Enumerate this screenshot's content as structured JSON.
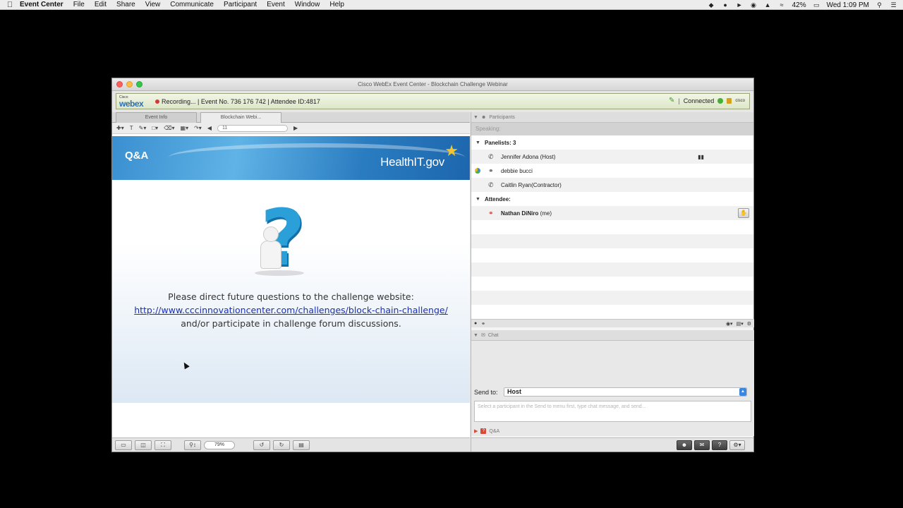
{
  "menubar": {
    "apple": "",
    "app_name": "Event Center",
    "items": [
      "File",
      "Edit",
      "Share",
      "View",
      "Communicate",
      "Participant",
      "Event",
      "Window",
      "Help"
    ],
    "battery": "42%",
    "clock": "Wed 1:09 PM"
  },
  "window": {
    "title": "Cisco WebEx Event Center - Blockchain Challenge Webinar",
    "status": {
      "cisco_label": "Cisco",
      "brand_label": "webex",
      "text": "Recording... | Event No. 736 176 742 | Attendee ID:4817",
      "connection": "Connected",
      "cisco_mark": "cisco"
    },
    "tabs": [
      "Event Info",
      "Blockchain Webi..."
    ],
    "toolbar": {
      "page_field": "11"
    },
    "slide": {
      "header_title": "Q&A",
      "brand": "HealthIT.gov",
      "line1": "Please direct future questions to the challenge website:",
      "link": "http://www.cccinnovationcenter.com/challenges/block-chain-challenge/",
      "line3": "and/or participate in challenge forum discussions."
    },
    "zoom": "79%"
  },
  "participants": {
    "panel_title": "Participants",
    "speaking_label": "Speaking:",
    "panelists_label": "Panelists: 3",
    "panelists": [
      {
        "name": "Jennifer Adona (Host)",
        "icon": "phone-icon"
      },
      {
        "name": "debbie bucci",
        "icon": "headset-icon"
      },
      {
        "name": "Caitlin Ryan(Contractor)",
        "icon": "phone-icon"
      }
    ],
    "attendee_label": "Attendee:",
    "attendee_name": "Nathan DiNiro",
    "attendee_suffix": "(me)"
  },
  "chat": {
    "panel_title": "Chat",
    "send_to_label": "Send to:",
    "send_to_value": "Host",
    "input_placeholder": "Select a participant in the Send to menu first, type chat message, and send...",
    "qa_label": "Q&A"
  },
  "colors": {
    "accent_blue": "#2b9fd8",
    "link_blue": "#1b2fb5",
    "recording_red": "#d63a2f",
    "connected_green": "#45b035"
  }
}
